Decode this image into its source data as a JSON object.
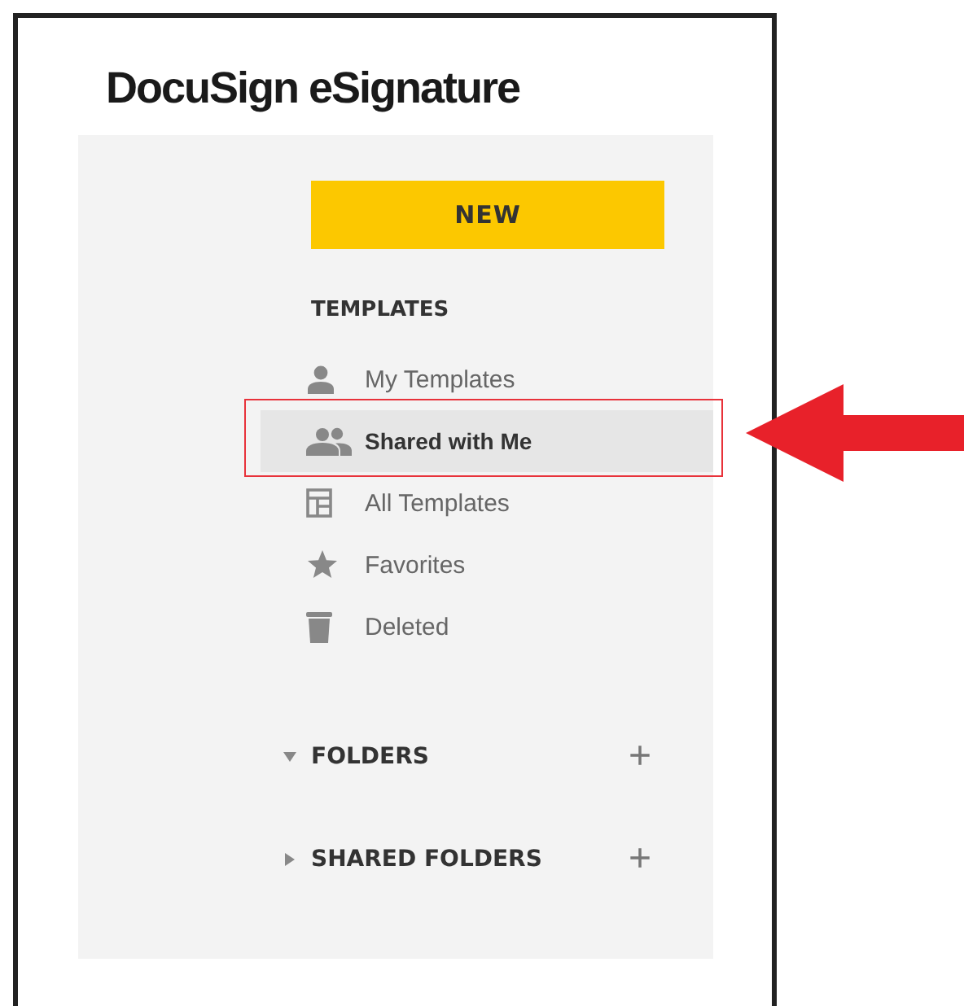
{
  "app_title": "DocuSign eSignature",
  "new_button": "NEW",
  "templates_heading": "TEMPLATES",
  "nav_items": [
    {
      "label": "My Templates",
      "kind": "person",
      "selected": false,
      "highlighted": false
    },
    {
      "label": "Shared with Me",
      "kind": "people",
      "selected": true,
      "highlighted": true
    },
    {
      "label": "All Templates",
      "kind": "layout",
      "selected": false,
      "highlighted": false
    },
    {
      "label": "Favorites",
      "kind": "star",
      "selected": false,
      "highlighted": false
    },
    {
      "label": "Deleted",
      "kind": "trash",
      "selected": false,
      "highlighted": false
    }
  ],
  "sections": [
    {
      "label": "FOLDERS",
      "expanded": true,
      "add": "+"
    },
    {
      "label": "SHARED FOLDERS",
      "expanded": false,
      "add": "+"
    }
  ]
}
